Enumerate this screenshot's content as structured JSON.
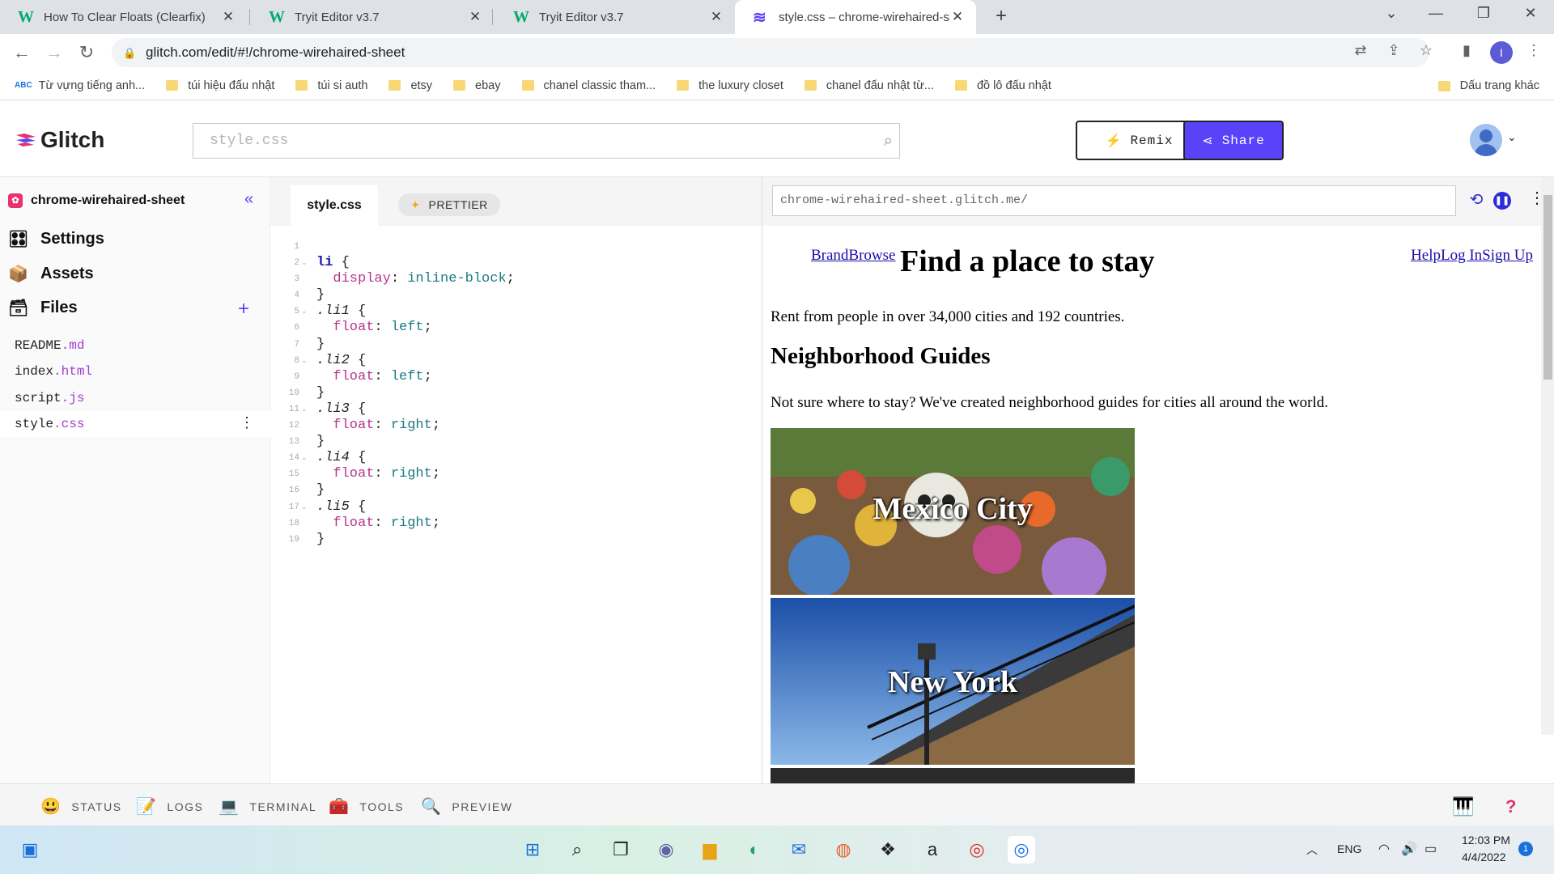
{
  "browser": {
    "tabs": [
      {
        "label": "How To Clear Floats (Clearfix)",
        "favicon": "W",
        "active": false
      },
      {
        "label": "Tryit Editor v3.7",
        "favicon": "W",
        "active": false
      },
      {
        "label": "Tryit Editor v3.7",
        "favicon": "W",
        "active": false
      },
      {
        "label": "style.css – chrome-wirehaired-sh",
        "favicon": "glitch-fish-icon",
        "active": true
      }
    ],
    "url": "glitch.com/edit/#!/chrome-wirehaired-sheet",
    "profile_initial": "I",
    "bookmarks": [
      {
        "label": "Từ vựng tiếng anh...",
        "icon": "abc-icon"
      },
      {
        "label": "túi hiệu đấu nhật",
        "icon": "folder-icon"
      },
      {
        "label": "túi si auth",
        "icon": "folder-icon"
      },
      {
        "label": "etsy",
        "icon": "folder-icon"
      },
      {
        "label": "ebay",
        "icon": "folder-icon"
      },
      {
        "label": "chanel classic tham...",
        "icon": "folder-icon"
      },
      {
        "label": "the luxury closet",
        "icon": "folder-icon"
      },
      {
        "label": "chanel đấu nhật từ...",
        "icon": "folder-icon"
      },
      {
        "label": "đồ lô đấu nhật",
        "icon": "folder-icon"
      }
    ],
    "other_bookmarks": "Dấu trang khác"
  },
  "glitch": {
    "logo_text": "Glitch",
    "search_placeholder": "style.css",
    "remix_label": "Remix",
    "share_label": "Share"
  },
  "sidebar": {
    "project_name": "chrome-wirehaired-sheet",
    "sections": [
      {
        "label": "Settings",
        "icon": "settings-icon"
      },
      {
        "label": "Assets",
        "icon": "assets-box-icon"
      },
      {
        "label": "Files",
        "icon": "files-icon"
      }
    ],
    "files": [
      {
        "name": "README",
        "ext": ".md",
        "selected": false
      },
      {
        "name": "index",
        "ext": ".html",
        "selected": false
      },
      {
        "name": "script",
        "ext": ".js",
        "selected": false
      },
      {
        "name": "style",
        "ext": ".css",
        "selected": true
      }
    ]
  },
  "editor": {
    "tab_label": "style.css",
    "prettier_label": "PRETTIER",
    "lines": [
      {
        "n": "1",
        "fold": false,
        "tokens": []
      },
      {
        "n": "2",
        "fold": true,
        "tokens": [
          [
            "sel",
            "li"
          ],
          [
            "plain",
            " {"
          ]
        ]
      },
      {
        "n": "3",
        "fold": false,
        "tokens": [
          [
            "plain",
            "  "
          ],
          [
            "prop",
            "display"
          ],
          [
            "plain",
            ": "
          ],
          [
            "val",
            "inline-block"
          ],
          [
            "plain",
            ";"
          ]
        ]
      },
      {
        "n": "4",
        "fold": false,
        "tokens": [
          [
            "plain",
            "}"
          ]
        ]
      },
      {
        "n": "5",
        "fold": true,
        "tokens": [
          [
            "cls",
            ".li1"
          ],
          [
            "plain",
            " {"
          ]
        ]
      },
      {
        "n": "6",
        "fold": false,
        "tokens": [
          [
            "plain",
            "  "
          ],
          [
            "prop",
            "float"
          ],
          [
            "plain",
            ": "
          ],
          [
            "val",
            "left"
          ],
          [
            "plain",
            ";"
          ]
        ]
      },
      {
        "n": "7",
        "fold": false,
        "tokens": [
          [
            "plain",
            "}"
          ]
        ]
      },
      {
        "n": "8",
        "fold": true,
        "tokens": [
          [
            "cls",
            ".li2"
          ],
          [
            "plain",
            " {"
          ]
        ]
      },
      {
        "n": "9",
        "fold": false,
        "tokens": [
          [
            "plain",
            "  "
          ],
          [
            "prop",
            "float"
          ],
          [
            "plain",
            ": "
          ],
          [
            "val",
            "left"
          ],
          [
            "plain",
            ";"
          ]
        ]
      },
      {
        "n": "10",
        "fold": false,
        "tokens": [
          [
            "plain",
            "}"
          ]
        ]
      },
      {
        "n": "11",
        "fold": true,
        "tokens": [
          [
            "cls",
            ".li3"
          ],
          [
            "plain",
            " {"
          ]
        ]
      },
      {
        "n": "12",
        "fold": false,
        "tokens": [
          [
            "plain",
            "  "
          ],
          [
            "prop",
            "float"
          ],
          [
            "plain",
            ": "
          ],
          [
            "val",
            "right"
          ],
          [
            "plain",
            ";"
          ]
        ]
      },
      {
        "n": "13",
        "fold": false,
        "tokens": [
          [
            "plain",
            "}"
          ]
        ]
      },
      {
        "n": "14",
        "fold": true,
        "tokens": [
          [
            "cls",
            ".li4"
          ],
          [
            "plain",
            " {"
          ]
        ]
      },
      {
        "n": "15",
        "fold": false,
        "tokens": [
          [
            "plain",
            "  "
          ],
          [
            "prop",
            "float"
          ],
          [
            "plain",
            ": "
          ],
          [
            "val",
            "right"
          ],
          [
            "plain",
            ";"
          ]
        ]
      },
      {
        "n": "16",
        "fold": false,
        "tokens": [
          [
            "plain",
            "}"
          ]
        ]
      },
      {
        "n": "17",
        "fold": true,
        "tokens": [
          [
            "cls",
            ".li5"
          ],
          [
            "plain",
            " {"
          ]
        ]
      },
      {
        "n": "18",
        "fold": false,
        "tokens": [
          [
            "plain",
            "  "
          ],
          [
            "prop",
            "float"
          ],
          [
            "plain",
            ": "
          ],
          [
            "val",
            "right"
          ],
          [
            "plain",
            ";"
          ]
        ]
      },
      {
        "n": "19",
        "fold": false,
        "tokens": [
          [
            "plain",
            "}"
          ]
        ]
      }
    ]
  },
  "preview": {
    "url": "chrome-wirehaired-sheet.glitch.me/",
    "nav_left": "BrandBrowse",
    "nav_right": "HelpLog InSign Up",
    "heading": "Find a place to stay",
    "intro": "Rent from people in over 34,000 cities and 192 countries.",
    "subheading": "Neighborhood Guides",
    "guides_text": "Not sure where to stay? We've created neighborhood guides for cities all around the world.",
    "cities": [
      "Mexico City",
      "New York"
    ]
  },
  "statusbar": {
    "items": [
      {
        "label": "STATUS",
        "icon": "smiley-icon"
      },
      {
        "label": "LOGS",
        "icon": "logs-icon"
      },
      {
        "label": "TERMINAL",
        "icon": "terminal-icon"
      },
      {
        "label": "TOOLS",
        "icon": "toolbox-icon"
      },
      {
        "label": "PREVIEW",
        "icon": "magnifier-icon"
      }
    ]
  },
  "taskbar": {
    "language": "ENG",
    "time": "12:03 PM",
    "date": "4/4/2022",
    "notification_count": "1"
  },
  "colors": {
    "accent": "#5a42f9",
    "glitch_pink": "#e6336b",
    "link": "#1a0dab"
  }
}
